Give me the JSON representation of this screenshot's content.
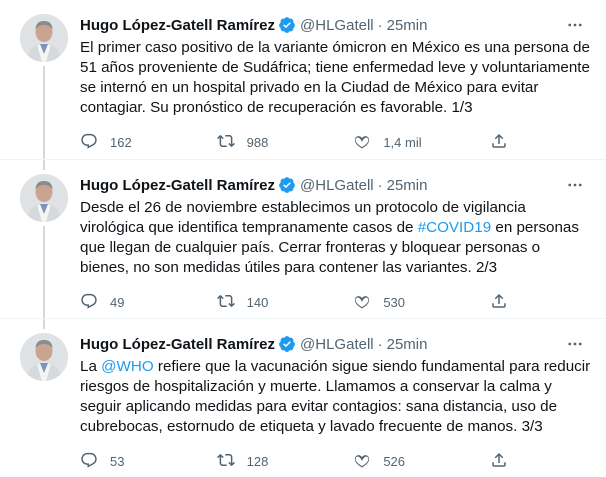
{
  "tweets": [
    {
      "author_name": "Hugo López-Gatell Ramírez",
      "handle": "@HLGatell",
      "separator": "·",
      "time": "25min",
      "text_parts": [
        {
          "text": "El primer caso positivo de la variante ómicron en México es una persona de 51 años proveniente de Sudáfrica; tiene enfermedad leve y voluntariamente se internó en un hospital privado en la Ciudad de México para evitar contagiar. Su pronóstico de recuperación es favorable. 1/3"
        }
      ],
      "replies": "162",
      "retweets": "988",
      "likes": "1,4 mil"
    },
    {
      "author_name": "Hugo López-Gatell Ramírez",
      "handle": "@HLGatell",
      "separator": "·",
      "time": "25min",
      "text_parts": [
        {
          "text": "Desde el 26 de noviembre establecimos un protocolo de vigilancia virológica que identifica tempranamente casos de "
        },
        {
          "text": "#COVID19",
          "link": true
        },
        {
          "text": " en personas que llegan de cualquier país. Cerrar fronteras y bloquear personas o bienes, no son medidas útiles para contener las variantes. 2/3"
        }
      ],
      "replies": "49",
      "retweets": "140",
      "likes": "530"
    },
    {
      "author_name": "Hugo López-Gatell Ramírez",
      "handle": "@HLGatell",
      "separator": "·",
      "time": "25min",
      "text_parts": [
        {
          "text": "La "
        },
        {
          "text": "@WHO",
          "link": true
        },
        {
          "text": " refiere que la vacunación sigue siendo fundamental para reducir riesgos de hospitalización y muerte. Llamamos a conservar la calma y seguir aplicando medidas para evitar contagios: sana distancia, uso de cubrebocas, estornudo de etiqueta y lavado frecuente de manos. 3/3"
        }
      ],
      "replies": "53",
      "retweets": "128",
      "likes": "526"
    }
  ],
  "icons": {
    "verified": "verified-badge-icon",
    "more": "more-options-icon",
    "reply": "reply-icon",
    "retweet": "retweet-icon",
    "like": "like-icon",
    "share": "share-icon"
  },
  "colors": {
    "link": "#1d9bf0",
    "secondary_text": "#536471",
    "thread_line": "#cfd9de",
    "verified": "#1d9bf0"
  }
}
